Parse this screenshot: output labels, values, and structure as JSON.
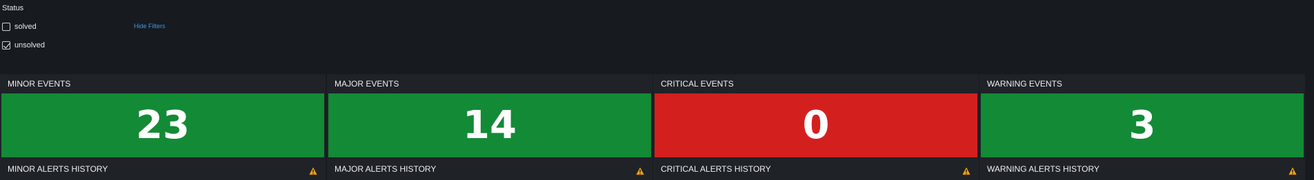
{
  "filters": {
    "status_label": "Status",
    "hide_filters_label": "Hide Filters",
    "options": [
      {
        "label": "solved",
        "checked": false
      },
      {
        "label": "unsolved",
        "checked": true
      }
    ]
  },
  "tiles": [
    {
      "title": "MINOR EVENTS",
      "value": "23",
      "history_title": "MINOR ALERTS HISTORY",
      "color": "#138a36"
    },
    {
      "title": "MAJOR EVENTS",
      "value": "14",
      "history_title": "MAJOR ALERTS HISTORY",
      "color": "#138a36"
    },
    {
      "title": "CRITICAL EVENTS",
      "value": "0",
      "history_title": "CRITICAL ALERTS HISTORY",
      "color": "#d41f1f"
    },
    {
      "title": "WARNING EVENTS",
      "value": "3",
      "history_title": "WARNING ALERTS HISTORY",
      "color": "#138a36"
    }
  ],
  "colors": {
    "success": "#138a36",
    "critical": "#d41f1f",
    "warning_icon": "#f2a20c",
    "link": "#3d9be0"
  },
  "icons": {
    "history_icon": "warning-triangle-icon"
  }
}
